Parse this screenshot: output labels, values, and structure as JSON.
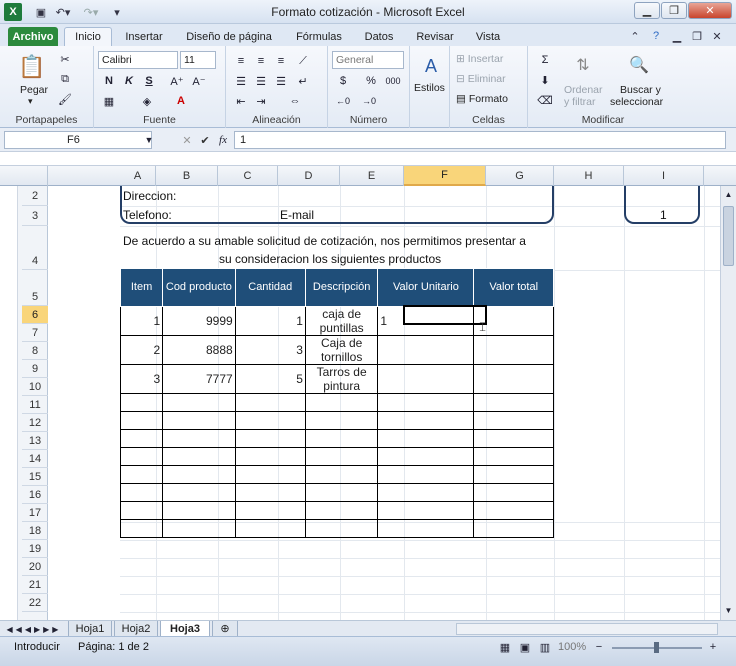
{
  "window": {
    "title": "Formato cotización  -  Microsoft Excel",
    "controls": [
      "▁",
      "❐",
      "✕"
    ]
  },
  "ribbon": {
    "tabs": [
      "Archivo",
      "Inicio",
      "Insertar",
      "Diseño de página",
      "Fórmulas",
      "Datos",
      "Revisar",
      "Vista"
    ],
    "active_tab": "Inicio",
    "groups": {
      "portapapeles": {
        "label": "Portapapeles",
        "paste": "Pegar"
      },
      "fuente": {
        "label": "Fuente",
        "font_name": "Calibri",
        "font_size": "11",
        "bold": "N",
        "italic": "K",
        "underline": "S"
      },
      "alineacion": {
        "label": "Alineación"
      },
      "numero": {
        "label": "Número",
        "format": "General",
        "pct": "%",
        "thousands": "000"
      },
      "estilos": {
        "label": "Estilos",
        "btn": "Estilos"
      },
      "celdas": {
        "label": "Celdas",
        "insert": "Insertar",
        "delete": "Eliminar",
        "format": "Formato"
      },
      "modificar": {
        "label": "Modificar",
        "sort": "Ordenar",
        "sort2": "y filtrar",
        "find": "Buscar y",
        "find2": "seleccionar"
      }
    }
  },
  "formula_bar": {
    "name_box": "F6",
    "fx": "fx",
    "value": "1"
  },
  "columns": [
    "A",
    "B",
    "C",
    "D",
    "E",
    "F",
    "G",
    "H",
    "I"
  ],
  "selected_column": "F",
  "rows": [
    "2",
    "3",
    "4",
    "5",
    "6",
    "7",
    "8",
    "9",
    "10",
    "11",
    "12",
    "13",
    "14",
    "15",
    "16",
    "17",
    "18",
    "19",
    "20",
    "21",
    "22"
  ],
  "selected_row": "6",
  "sheet": {
    "direccion": "Direccion:",
    "telefono": "Telefono:",
    "email": "E-mail",
    "page_num": "1",
    "intro_line1": "De acuerdo a su amable solicitud de cotización, nos permitimos presentar a",
    "intro_line2": "su consideracion los siguientes productos",
    "headers": [
      "Item",
      "Cod producto",
      "Cantidad",
      "Descripción",
      "Valor Unitario",
      "Valor total"
    ],
    "items": [
      {
        "item": "1",
        "cod": "9999",
        "cant": "1",
        "desc": "caja de puntillas",
        "unit": "1",
        "total": ""
      },
      {
        "item": "2",
        "cod": "8888",
        "cant": "3",
        "desc": "Caja de tornillos",
        "unit": "",
        "total": ""
      },
      {
        "item": "3",
        "cod": "7777",
        "cant": "5",
        "desc": "Tarros de pintura",
        "unit": "",
        "total": ""
      }
    ],
    "empty_rows": 8
  },
  "sheet_tabs": [
    "Hoja1",
    "Hoja2",
    "Hoja3"
  ],
  "active_sheet": "Hoja3",
  "status": {
    "mode": "Introducir",
    "page": "Página: 1 de 2",
    "zoom": "100%"
  },
  "colors": {
    "header_fill": "#1f4e79",
    "selection": "#f9d57a",
    "file_tab": "#2c8a3d"
  }
}
